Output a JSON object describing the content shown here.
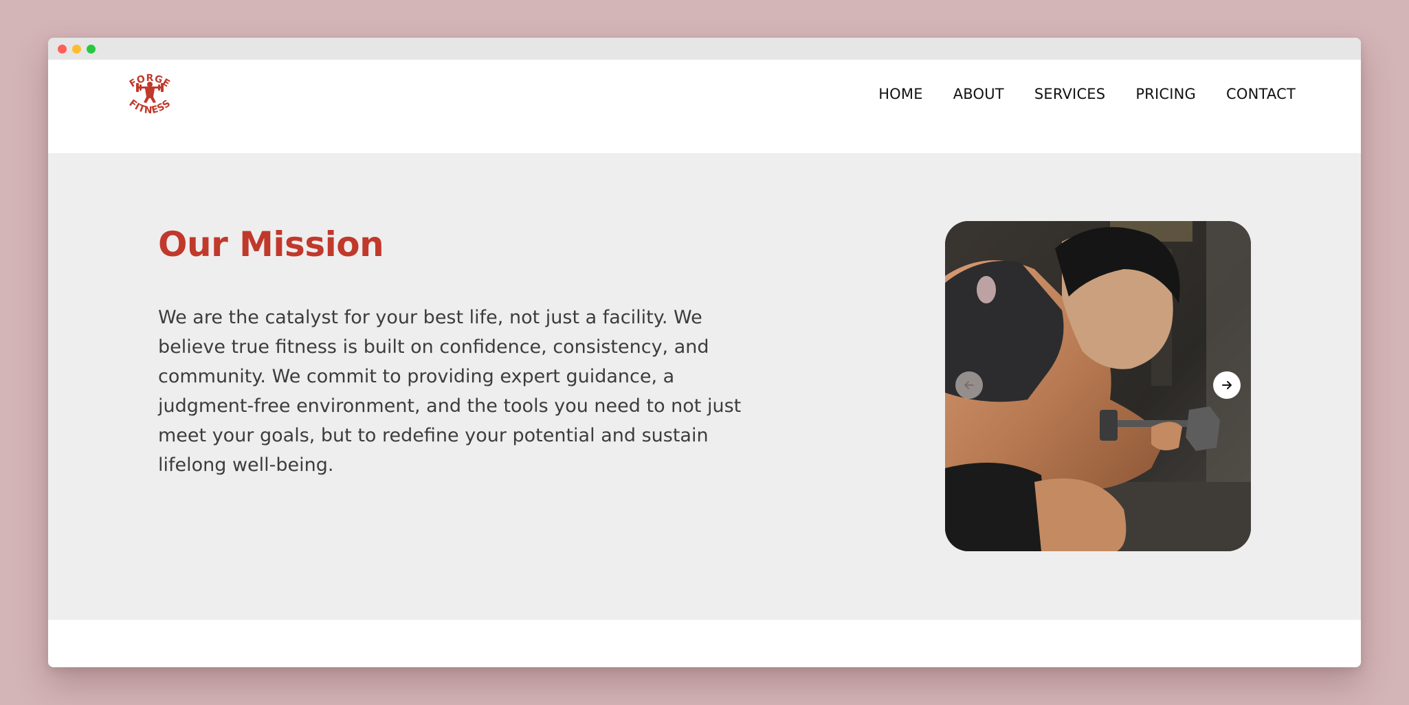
{
  "brand": {
    "logo_top": "FORGE",
    "logo_bottom": "FITNESS",
    "accent_color": "#c0392b"
  },
  "nav": {
    "items": [
      {
        "label": "HOME",
        "name": "nav-home"
      },
      {
        "label": "ABOUT",
        "name": "nav-about"
      },
      {
        "label": "SERVICES",
        "name": "nav-services"
      },
      {
        "label": "PRICING",
        "name": "nav-pricing"
      },
      {
        "label": "CONTACT",
        "name": "nav-contact"
      }
    ]
  },
  "mission": {
    "title": "Our Mission",
    "body": "We are the catalyst for your best life, not just a facility. We believe true fitness is built on confidence, consistency, and community. We commit to providing expert guidance, a judgment-free environment, and the tools you need to not just meet your goals, but to redefine your potential and sustain lifelong well-being."
  },
  "carousel": {
    "prev_icon": "arrow-left-icon",
    "next_icon": "arrow-right-icon"
  }
}
